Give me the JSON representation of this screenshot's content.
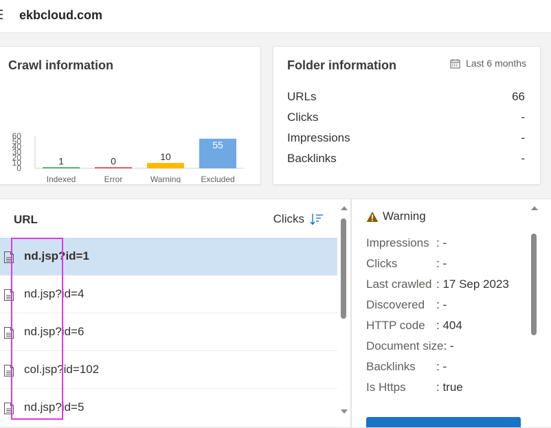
{
  "topbar": {
    "site": "ekbcloud.com"
  },
  "crawl": {
    "title": "Crawl information"
  },
  "chart_data": {
    "type": "bar",
    "categories": [
      "Indexed",
      "Error",
      "Warning",
      "Excluded"
    ],
    "values": [
      1,
      0,
      10,
      55
    ],
    "colors": [
      "#2e9e3e",
      "#d13438",
      "#ffb900",
      "#6fa9e3"
    ],
    "ylim": [
      0,
      60
    ],
    "yticks": [
      0,
      10,
      20,
      30,
      40,
      50,
      60
    ],
    "grid": false,
    "title": "",
    "xlabel": "",
    "ylabel": ""
  },
  "folder": {
    "title": "Folder information",
    "date_range": "Last 6 months",
    "rows": [
      {
        "label": "URLs",
        "value": "66"
      },
      {
        "label": "Clicks",
        "value": "-"
      },
      {
        "label": "Impressions",
        "value": "-"
      },
      {
        "label": "Backlinks",
        "value": "-"
      }
    ]
  },
  "list": {
    "col_url": "URL",
    "col_clicks": "Clicks",
    "rows": [
      {
        "name": "nd.jsp?id=1",
        "selected": true
      },
      {
        "name": "nd.jsp?id=4"
      },
      {
        "name": "nd.jsp?id=6"
      },
      {
        "name": "col.jsp?id=102"
      },
      {
        "name": "nd.jsp?id=5"
      }
    ]
  },
  "details": {
    "status": "Warning",
    "rows": [
      {
        "label": "Impressions",
        "value": ": -"
      },
      {
        "label": "Clicks",
        "value": ": -"
      },
      {
        "label": "Last crawled",
        "value": ": 17 Sep 2023"
      },
      {
        "label": "Discovered",
        "value": ": -"
      },
      {
        "label": "HTTP code",
        "value": ": 404"
      },
      {
        "label": "Document size",
        "value": ": -"
      },
      {
        "label": "Backlinks",
        "value": ": -"
      },
      {
        "label": "Is Https",
        "value": ": true"
      }
    ]
  },
  "colors": {
    "accent": "#1a73c9",
    "selected_row": "#cfe2f3",
    "highlight": "#e036e0",
    "warning": "#8a5b00"
  }
}
